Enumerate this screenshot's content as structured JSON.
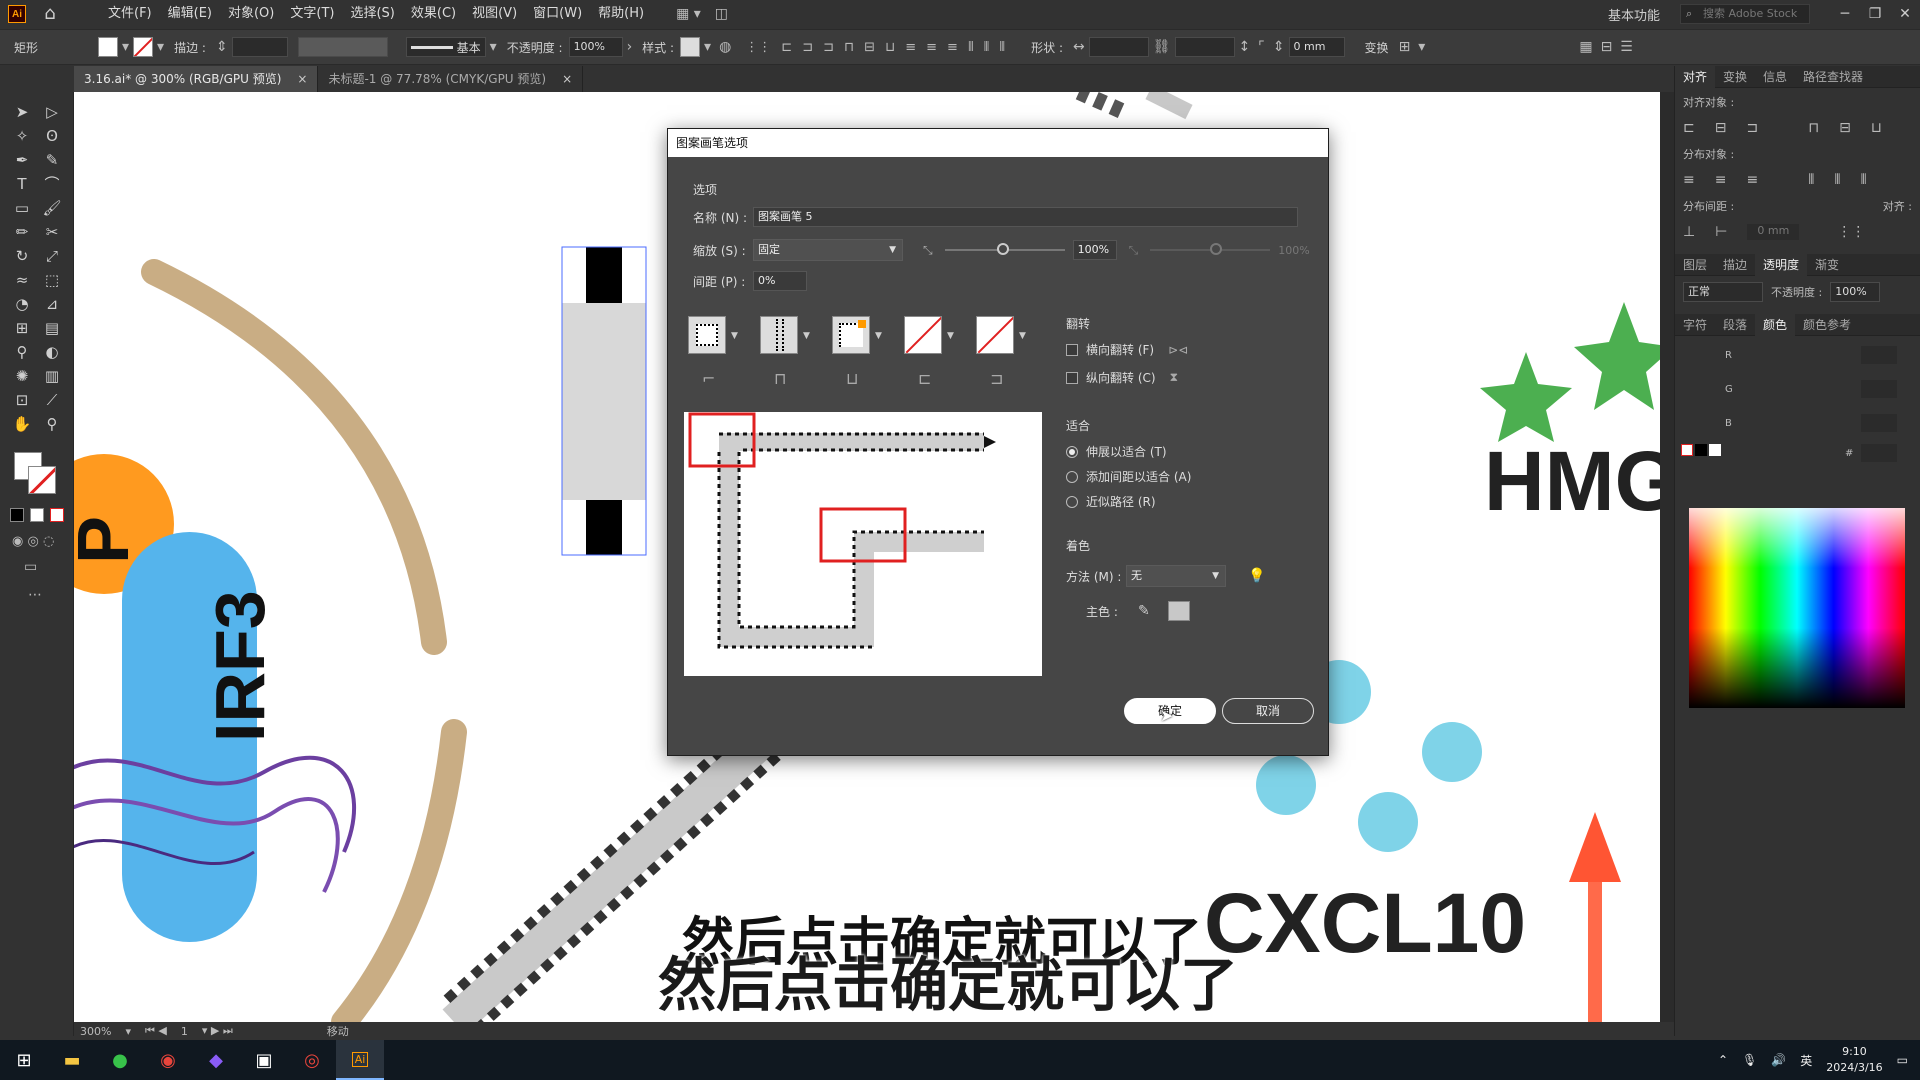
{
  "app": {
    "logo": "Ai"
  },
  "menu": {
    "items": [
      "文件(F)",
      "编辑(E)",
      "对象(O)",
      "文字(T)",
      "选择(S)",
      "效果(C)",
      "视图(V)",
      "窗口(W)",
      "帮助(H)"
    ]
  },
  "workspace": {
    "label": "基本功能",
    "search_placeholder": "搜索 Adobe Stock"
  },
  "control_bar": {
    "tool_label": "矩形",
    "stroke_label": "描边 :",
    "stroke_style": "基本",
    "opacity_label": "不透明度 :",
    "opacity_value": "100%",
    "style_label": "样式 :",
    "shape_label": "形状 :",
    "mm_value": "0 mm",
    "transform_label": "变换"
  },
  "tabs": [
    {
      "label": "3.16.ai* @ 300% (RGB/GPU 预览)",
      "close": "×"
    },
    {
      "label": "未标题-1 @ 77.78% (CMYK/GPU 预览)",
      "close": "×"
    }
  ],
  "status": {
    "zoom": "300%",
    "page": "1",
    "tool_status": "移动"
  },
  "right_panel": {
    "tabs_top": [
      "对齐",
      "变换",
      "信息",
      "路径查找器"
    ],
    "align_objects_label": "对齐对象 :",
    "distribute_objects_label": "分布对象 :",
    "distribute_spacing_label": "分布间距 :",
    "align_to_label": "对齐 :",
    "spacing_value": "0 mm",
    "tabs_mid": [
      "图层",
      "描边",
      "透明度",
      "渐变"
    ],
    "blend_mode": "正常",
    "opacity_label": "不透明度 :",
    "opacity_value": "100%",
    "tabs_color": [
      "字符",
      "段落",
      "颜色",
      "颜色参考"
    ],
    "channels": [
      "R",
      "G",
      "B"
    ],
    "hash": "#"
  },
  "canvas": {
    "hmg_text": "HMG",
    "cxcl_text": "CXCL10",
    "irf_text": "IRF3",
    "p_text": "P"
  },
  "dialog": {
    "title": "图案画笔选项",
    "options_section": "选项",
    "name_label": "名称 (N) :",
    "name_value": "图案画笔 5",
    "scale_label": "缩放 (S) :",
    "scale_value": "固定",
    "scale_pct": "100%",
    "scale_pct2": "100%",
    "spacing_label": "间距 (P) :",
    "spacing_value": "0%",
    "flip_section": "翻转",
    "flip_h": "横向翻转 (F)",
    "flip_v": "纵向翻转 (C)",
    "fit_section": "适合",
    "fit_options": [
      "伸展以适合 (T)",
      "添加间距以适合 (A)",
      "近似路径 (R)"
    ],
    "colorize_section": "着色",
    "method_label": "方法 (M) :",
    "method_value": "无",
    "key_color_label": "主色 :",
    "ok_label": "确定",
    "cancel_label": "取消"
  },
  "subtitles": {
    "line1": "然后点击确定就可以了",
    "line2": "然后点击确定就可以了"
  },
  "taskbar": {
    "lang": "英",
    "time": "9:10",
    "date": "2024/3/16"
  },
  "colors": {
    "accent_orange": "#ff9a00",
    "highlight_red": "#e02020",
    "beige": "#c9ad84",
    "cyan": "#7fd3e8",
    "green_star": "#4caf50"
  }
}
